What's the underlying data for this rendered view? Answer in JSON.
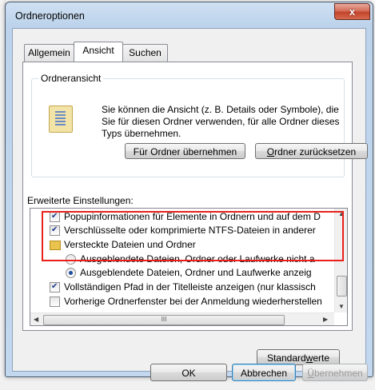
{
  "window": {
    "title": "Ordneroptionen",
    "close_glyph": "x"
  },
  "tabs": [
    {
      "label": "Allgemein",
      "active": false
    },
    {
      "label": "Ansicht",
      "active": true
    },
    {
      "label": "Suchen",
      "active": false
    }
  ],
  "folder_view": {
    "group_label": "Ordneransicht",
    "description": "Sie können die Ansicht (z. B. Details oder Symbole), die Sie für diesen Ordner verwenden, für alle Ordner dieses Typs übernehmen.",
    "apply_button": "Für Ordner übernehmen",
    "reset_button_underlined": "O",
    "reset_button_rest": "rdner zurücksetzen",
    "icon": "folder-view-icon"
  },
  "advanced": {
    "label": "Erweiterte Einstellungen:",
    "items": [
      {
        "type": "checkbox",
        "checked": true,
        "label": "Popupinformationen für Elemente in Ordnern und auf dem D",
        "indent": 0
      },
      {
        "type": "checkbox",
        "checked": true,
        "label": "Verschlüsselte oder komprimierte NTFS-Dateien in anderer",
        "indent": 0
      },
      {
        "type": "folder",
        "label": "Versteckte Dateien und Ordner",
        "indent": 0
      },
      {
        "type": "radio",
        "checked": false,
        "label": "Ausgeblendete Dateien, Ordner oder Laufwerke nicht a",
        "indent": 1
      },
      {
        "type": "radio",
        "checked": true,
        "label": "Ausgeblendete Dateien, Ordner und Laufwerke anzeig",
        "indent": 1
      },
      {
        "type": "checkbox",
        "checked": true,
        "label": "Vollständigen Pfad in der Titelleiste anzeigen (nur klassisch",
        "indent": 0
      },
      {
        "type": "checkbox",
        "checked": false,
        "label": "Vorherige Ordnerfenster bei der Anmeldung wiederherstellen",
        "indent": 0
      }
    ],
    "hscroll_thumb_glyph": "III"
  },
  "buttons": {
    "defaults_prefix": "Standard",
    "defaults_underlined": "w",
    "defaults_suffix": "erte",
    "ok": "OK",
    "cancel": "Abbrechen",
    "apply_underlined": "Ü",
    "apply_rest": "bernehmen"
  },
  "colors": {
    "highlight_box": "#e8221b",
    "title_bar": "#c3d8ee",
    "close_button": "#c3432b"
  }
}
